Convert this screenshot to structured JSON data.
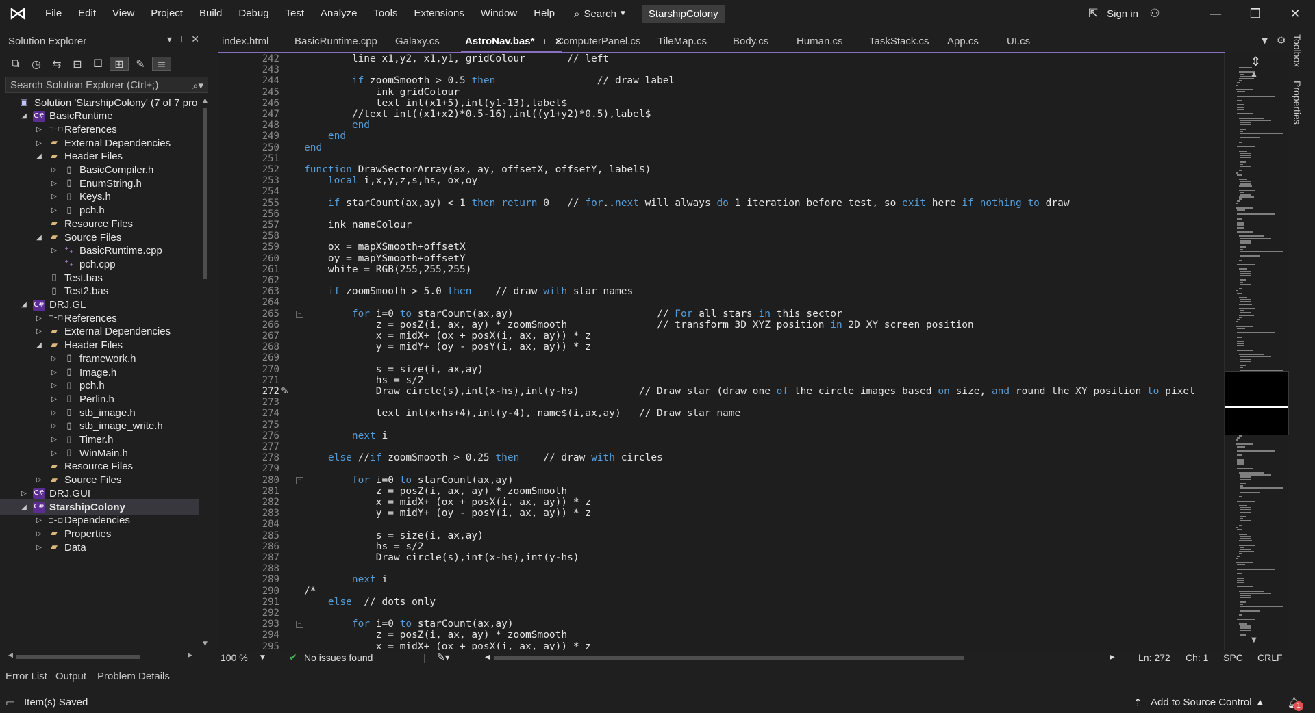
{
  "menu": {
    "items": [
      "File",
      "Edit",
      "View",
      "Project",
      "Build",
      "Debug",
      "Test",
      "Analyze",
      "Tools",
      "Extensions",
      "Window",
      "Help"
    ],
    "search_label": "Search",
    "solution_badge": "StarshipColony",
    "sign_in": "Sign in"
  },
  "solution_explorer": {
    "title": "Solution Explorer",
    "search_placeholder": "Search Solution Explorer (Ctrl+;)",
    "tree": [
      {
        "label": "Solution 'StarshipColony' (7 of 7 pro",
        "depth": 0,
        "chev": "",
        "icon": "solution"
      },
      {
        "label": "BasicRuntime",
        "depth": 1,
        "chev": "open",
        "icon": "project"
      },
      {
        "label": "References",
        "depth": 2,
        "chev": "closed",
        "icon": "ref"
      },
      {
        "label": "External Dependencies",
        "depth": 2,
        "chev": "closed",
        "icon": "folder"
      },
      {
        "label": "Header Files",
        "depth": 2,
        "chev": "open",
        "icon": "folder"
      },
      {
        "label": "BasicCompiler.h",
        "depth": 3,
        "chev": "closed",
        "icon": "file"
      },
      {
        "label": "EnumString.h",
        "depth": 3,
        "chev": "closed",
        "icon": "file"
      },
      {
        "label": "Keys.h",
        "depth": 3,
        "chev": "closed",
        "icon": "file"
      },
      {
        "label": "pch.h",
        "depth": 3,
        "chev": "closed",
        "icon": "file"
      },
      {
        "label": "Resource Files",
        "depth": 2,
        "chev": "",
        "icon": "folder"
      },
      {
        "label": "Source Files",
        "depth": 2,
        "chev": "open",
        "icon": "folder"
      },
      {
        "label": "BasicRuntime.cpp",
        "depth": 3,
        "chev": "closed",
        "icon": "cpp"
      },
      {
        "label": "pch.cpp",
        "depth": 3,
        "chev": "",
        "icon": "cpp"
      },
      {
        "label": "Test.bas",
        "depth": 2,
        "chev": "",
        "icon": "file"
      },
      {
        "label": "Test2.bas",
        "depth": 2,
        "chev": "",
        "icon": "file"
      },
      {
        "label": "DRJ.GL",
        "depth": 1,
        "chev": "open",
        "icon": "project"
      },
      {
        "label": "References",
        "depth": 2,
        "chev": "closed",
        "icon": "ref"
      },
      {
        "label": "External Dependencies",
        "depth": 2,
        "chev": "closed",
        "icon": "folder"
      },
      {
        "label": "Header Files",
        "depth": 2,
        "chev": "open",
        "icon": "folder"
      },
      {
        "label": "framework.h",
        "depth": 3,
        "chev": "closed",
        "icon": "file"
      },
      {
        "label": "Image.h",
        "depth": 3,
        "chev": "closed",
        "icon": "file"
      },
      {
        "label": "pch.h",
        "depth": 3,
        "chev": "closed",
        "icon": "file"
      },
      {
        "label": "Perlin.h",
        "depth": 3,
        "chev": "closed",
        "icon": "file"
      },
      {
        "label": "stb_image.h",
        "depth": 3,
        "chev": "closed",
        "icon": "file"
      },
      {
        "label": "stb_image_write.h",
        "depth": 3,
        "chev": "closed",
        "icon": "file"
      },
      {
        "label": "Timer.h",
        "depth": 3,
        "chev": "closed",
        "icon": "file"
      },
      {
        "label": "WinMain.h",
        "depth": 3,
        "chev": "closed",
        "icon": "file"
      },
      {
        "label": "Resource Files",
        "depth": 2,
        "chev": "",
        "icon": "folder"
      },
      {
        "label": "Source Files",
        "depth": 2,
        "chev": "closed",
        "icon": "folder"
      },
      {
        "label": "DRJ.GUI",
        "depth": 1,
        "chev": "closed",
        "icon": "project"
      },
      {
        "label": "StarshipColony",
        "depth": 1,
        "chev": "open",
        "icon": "project",
        "selected": true
      },
      {
        "label": "Dependencies",
        "depth": 2,
        "chev": "closed",
        "icon": "ref"
      },
      {
        "label": "Properties",
        "depth": 2,
        "chev": "closed",
        "icon": "folder"
      },
      {
        "label": "Data",
        "depth": 2,
        "chev": "closed",
        "icon": "folder"
      }
    ]
  },
  "tabs": [
    {
      "label": "index.html"
    },
    {
      "label": "BasicRuntime.cpp"
    },
    {
      "label": "Galaxy.cs"
    },
    {
      "label": "AstroNav.bas*",
      "active": true
    },
    {
      "label": "ComputerPanel.cs"
    },
    {
      "label": "TileMap.cs"
    },
    {
      "label": "Body.cs"
    },
    {
      "label": "Human.cs"
    },
    {
      "label": "TaskStack.cs"
    },
    {
      "label": "App.cs"
    },
    {
      "label": "UI.cs"
    }
  ],
  "editor": {
    "current_line": 272,
    "lines": [
      {
        "n": 242,
        "code": "        line x1,y2, x1,y1, gridColour       // left"
      },
      {
        "n": 243,
        "code": ""
      },
      {
        "n": 244,
        "code": "        if zoomSmooth > 0.5 then                 // draw label"
      },
      {
        "n": 245,
        "code": "            ink gridColour"
      },
      {
        "n": 246,
        "code": "            text int(x1+5),int(y1-13),label$"
      },
      {
        "n": 247,
        "code": "        //text int((x1+x2)*0.5-16),int((y1+y2)*0.5),label$"
      },
      {
        "n": 248,
        "code": "        end"
      },
      {
        "n": 249,
        "code": "    end"
      },
      {
        "n": 250,
        "code": "end"
      },
      {
        "n": 251,
        "code": ""
      },
      {
        "n": 252,
        "code": "function DrawSectorArray(ax, ay, offsetX, offsetY, label$)"
      },
      {
        "n": 253,
        "code": "    local i,x,y,z,s,hs, ox,oy"
      },
      {
        "n": 254,
        "code": ""
      },
      {
        "n": 255,
        "code": "    if starCount(ax,ay) < 1 then return 0   // for..next will always do 1 iteration before test, so exit here if nothing to draw"
      },
      {
        "n": 256,
        "code": ""
      },
      {
        "n": 257,
        "code": "    ink nameColour"
      },
      {
        "n": 258,
        "code": ""
      },
      {
        "n": 259,
        "code": "    ox = mapXSmooth+offsetX"
      },
      {
        "n": 260,
        "code": "    oy = mapYSmooth+offsetY"
      },
      {
        "n": 261,
        "code": "    white = RGB(255,255,255)"
      },
      {
        "n": 262,
        "code": ""
      },
      {
        "n": 263,
        "code": "    if zoomSmooth > 5.0 then    // draw with star names"
      },
      {
        "n": 264,
        "code": ""
      },
      {
        "n": 265,
        "code": "        for i=0 to starCount(ax,ay)                        // For all stars in this sector"
      },
      {
        "n": 266,
        "code": "            z = posZ(i, ax, ay) * zoomSmooth               // transform 3D XYZ position in 2D XY screen position"
      },
      {
        "n": 267,
        "code": "            x = midX+ (ox + posX(i, ax, ay)) * z"
      },
      {
        "n": 268,
        "code": "            y = midY+ (oy - posY(i, ax, ay)) * z"
      },
      {
        "n": 269,
        "code": ""
      },
      {
        "n": 270,
        "code": "            s = size(i, ax,ay)"
      },
      {
        "n": 271,
        "code": "            hs = s/2"
      },
      {
        "n": 272,
        "code": "            Draw circle(s),int(x-hs),int(y-hs)          // Draw star (draw one of the circle images based on size, and round the XY position to pixel"
      },
      {
        "n": 273,
        "code": ""
      },
      {
        "n": 274,
        "code": "            text int(x+hs+4),int(y-4), name$(i,ax,ay)   // Draw star name"
      },
      {
        "n": 275,
        "code": ""
      },
      {
        "n": 276,
        "code": "        next i"
      },
      {
        "n": 277,
        "code": ""
      },
      {
        "n": 278,
        "code": "    else //if zoomSmooth > 0.25 then    // draw with circles"
      },
      {
        "n": 279,
        "code": ""
      },
      {
        "n": 280,
        "code": "        for i=0 to starCount(ax,ay)"
      },
      {
        "n": 281,
        "code": "            z = posZ(i, ax, ay) * zoomSmooth"
      },
      {
        "n": 282,
        "code": "            x = midX+ (ox + posX(i, ax, ay)) * z"
      },
      {
        "n": 283,
        "code": "            y = midY+ (oy - posY(i, ax, ay)) * z"
      },
      {
        "n": 284,
        "code": ""
      },
      {
        "n": 285,
        "code": "            s = size(i, ax,ay)"
      },
      {
        "n": 286,
        "code": "            hs = s/2"
      },
      {
        "n": 287,
        "code": "            Draw circle(s),int(x-hs),int(y-hs)"
      },
      {
        "n": 288,
        "code": ""
      },
      {
        "n": 289,
        "code": "        next i"
      },
      {
        "n": 290,
        "code": "/*"
      },
      {
        "n": 291,
        "code": "    else  // dots only"
      },
      {
        "n": 292,
        "code": ""
      },
      {
        "n": 293,
        "code": "        for i=0 to starCount(ax,ay)"
      },
      {
        "n": 294,
        "code": "            z = posZ(i, ax, ay) * zoomSmooth"
      },
      {
        "n": 295,
        "code": "            x = midX+ (ox + posX(i, ax, ay)) * z"
      }
    ],
    "fold_lines": [
      265,
      280,
      293
    ]
  },
  "editor_status": {
    "zoom": "100 %",
    "issues": "No issues found",
    "ln": "Ln: 272",
    "ch": "Ch: 1",
    "spc": "SPC",
    "crlf": "CRLF"
  },
  "side_tool_labels": [
    "Toolbox",
    "Properties"
  ],
  "bottom_tabs": [
    "Error List",
    "Output",
    "Problem Details"
  ],
  "status": {
    "left": "Item(s) Saved",
    "source_control": "Add to Source Control",
    "notifications": "1"
  },
  "colors": {
    "keyword": "#569cd6",
    "accent": "#8a6fc0",
    "background": "#1f1f1f"
  }
}
